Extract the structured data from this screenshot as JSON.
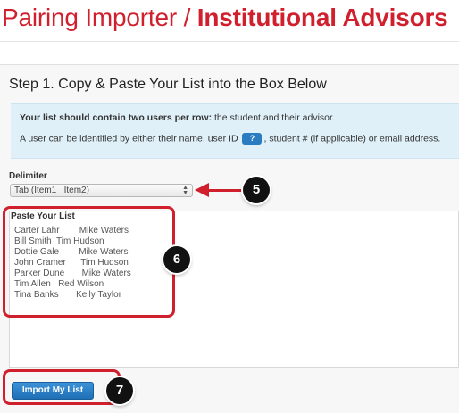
{
  "header": {
    "title_prefix": "Pairing Importer / ",
    "title_bold": "Institutional Advisors"
  },
  "step": {
    "heading": "Step 1. Copy & Paste Your List into the Box Below"
  },
  "info": {
    "line1_strong": "Your list should contain two users per row:",
    "line1_rest": " the student and their advisor.",
    "line2_before": "A user can be identified by either their name, user ID",
    "help_badge": "?",
    "line2_after": ", student # (if applicable) or email address."
  },
  "delimiter": {
    "label": "Delimiter",
    "selected": "Tab (Item1   Item2)",
    "arrows": "▲\n▼"
  },
  "paste": {
    "label": "Paste Your List",
    "lines": [
      "Carter Lahr        Mike Waters",
      "Bill Smith  Tim Hudson",
      "Dottie Gale        Mike Waters",
      "John Cramer      Tim Hudson",
      "Parker Dune       Mike Waters",
      "Tim Allen   Red Wilson",
      "Tina Banks       Kelly Taylor"
    ]
  },
  "actions": {
    "import_label": "Import My List"
  },
  "badges": {
    "five": "5",
    "six": "6",
    "seven": "7"
  },
  "colors": {
    "brand_red": "#d0202e",
    "info_bg": "#dff0f8",
    "button_blue": "#2a7bbf"
  }
}
